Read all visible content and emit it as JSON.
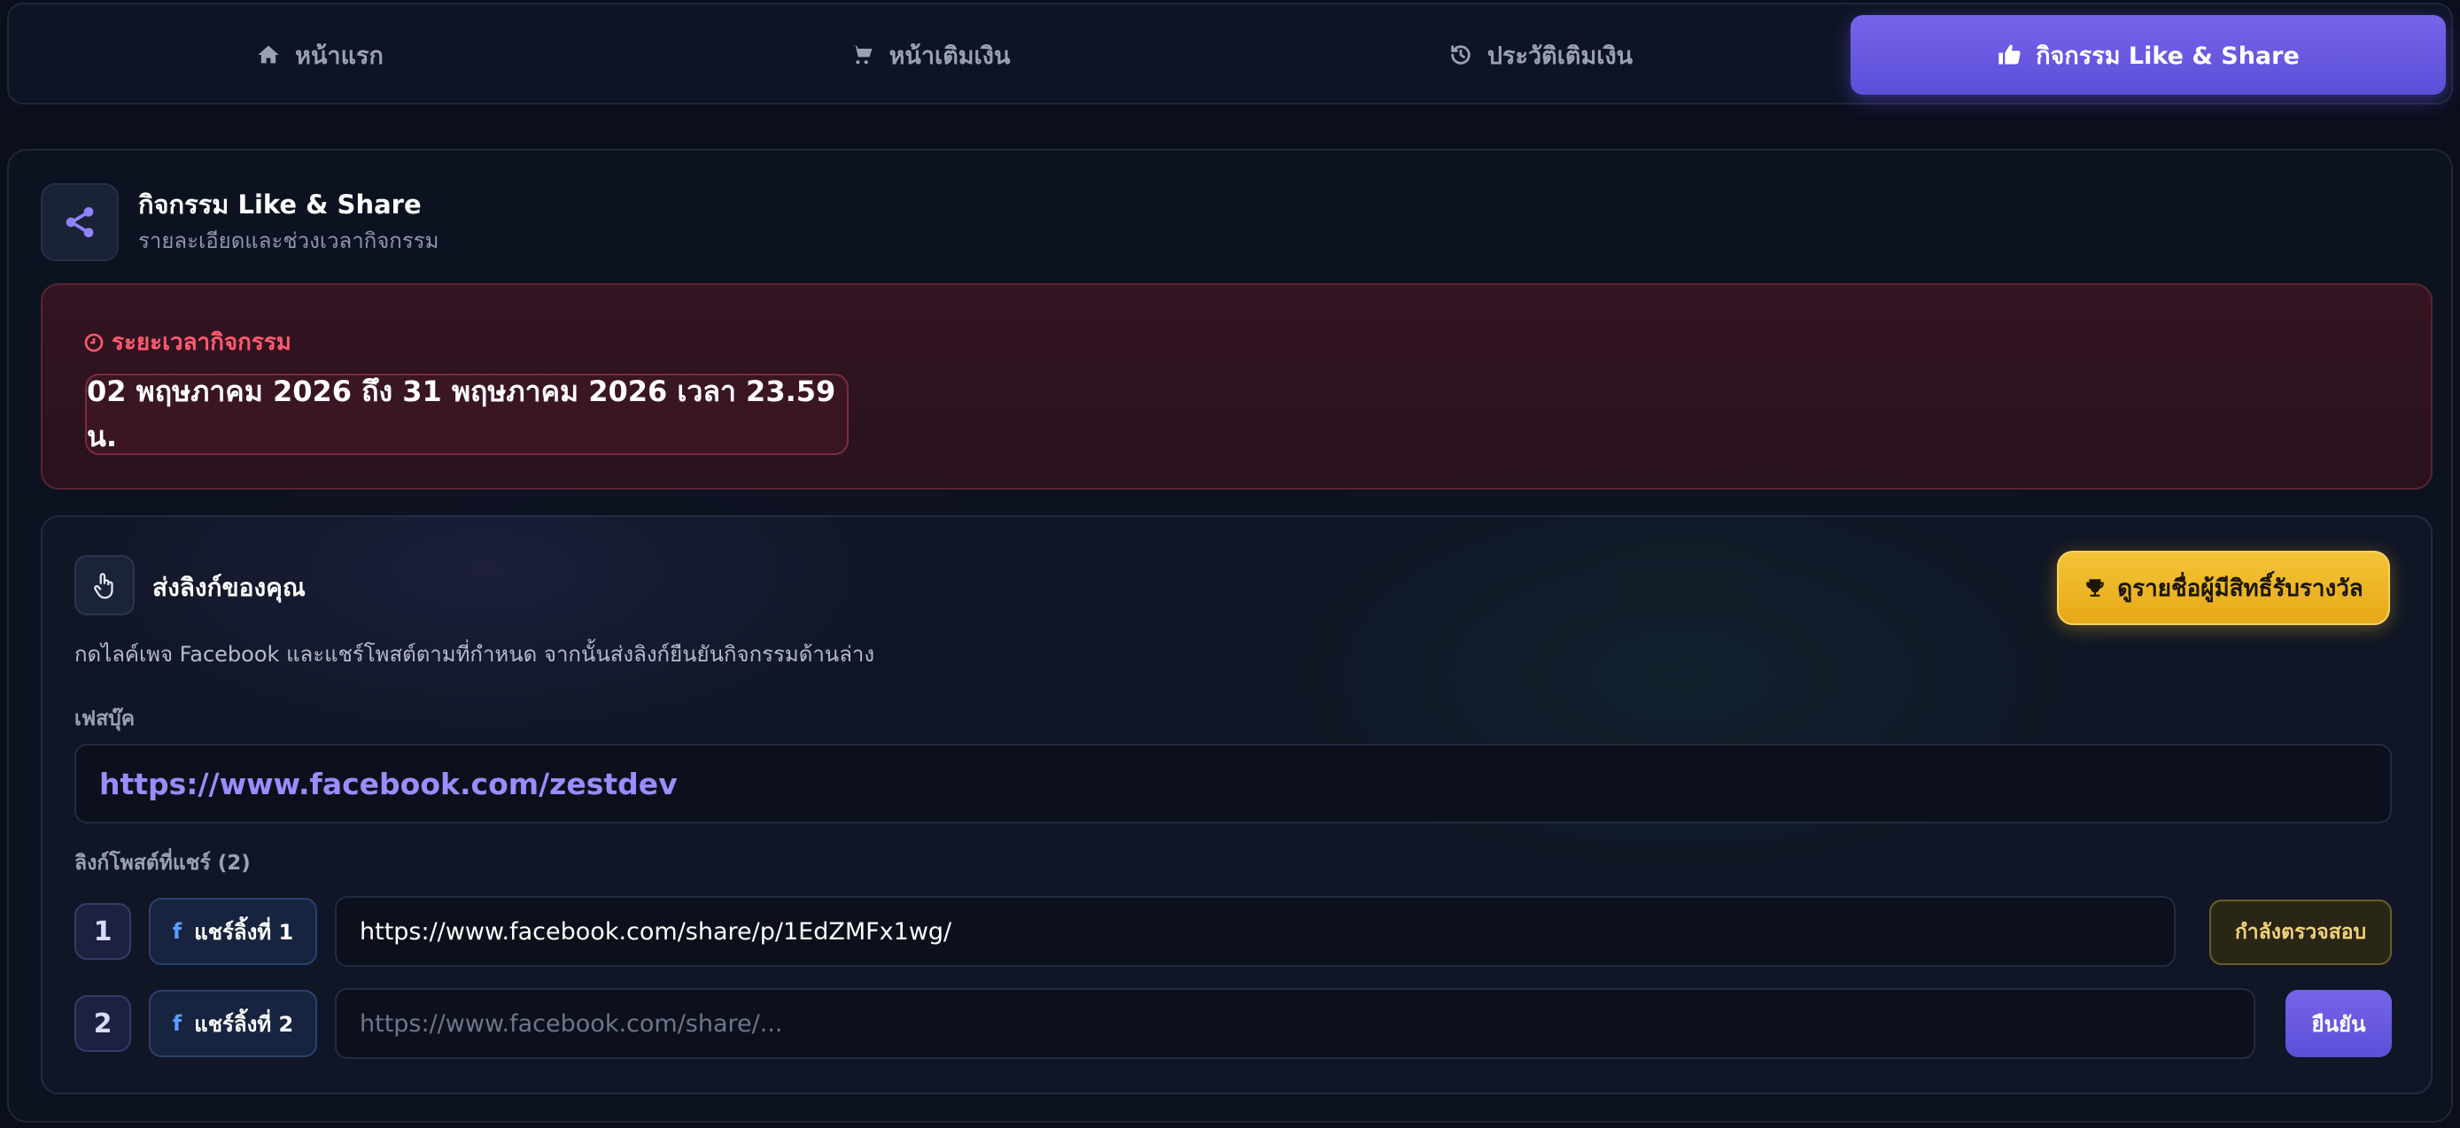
{
  "nav": {
    "tabs": [
      {
        "label": "หน้าแรก",
        "icon": "home-icon"
      },
      {
        "label": "หน้าเติมเงิน",
        "icon": "cart-icon"
      },
      {
        "label": "ประวัติเติมเงิน",
        "icon": "history-icon"
      },
      {
        "label": "กิจกรรม Like & Share",
        "icon": "thumbs-up-icon",
        "active": true
      }
    ]
  },
  "header": {
    "title": "กิจกรรม Like & Share",
    "subtitle": "รายละเอียดและช่วงเวลากิจกรรม",
    "icon": "share-icon"
  },
  "period": {
    "label": "ระยะเวลากิจกรรม",
    "range": "02 พฤษภาคม 2026 ถึง 31 พฤษภาคม 2026 เวลา 23.59 น.",
    "icon": "clock-icon"
  },
  "submit": {
    "title": "ส่งลิงก์ของคุณ",
    "icon": "pointer-hand-icon",
    "winners_button": "ดูรายชื่อผู้มีสิทธิ์รับรางวัล",
    "winners_icon": "trophy-icon",
    "instructions": "กดไลค์เพจ Facebook และแชร์โพสต์ตามที่กำหนด จากนั้นส่งลิงก์ยืนยันกิจกรรมด้านล่าง",
    "facebook_label": "เฟสบุ๊ค",
    "facebook_url": "https://www.facebook.com/zestdev",
    "links_label": "ลิงก์โพสต์ที่แชร์ (2)",
    "rows": [
      {
        "number": "1",
        "share_label": "แชร์ลิ้งที่ 1",
        "value": "https://www.facebook.com/share/p/1EdZMFx1wg/",
        "status": "กำลังตรวจสอบ"
      },
      {
        "number": "2",
        "share_label": "แชร์ลิ้งที่ 2",
        "placeholder": "https://www.facebook.com/share/...",
        "button": "ยืนยัน"
      }
    ]
  },
  "colors": {
    "accent": "#6a5ae0",
    "danger": "#ff5a6e",
    "gold": "#f0b72a",
    "link": "#9b8cff"
  }
}
